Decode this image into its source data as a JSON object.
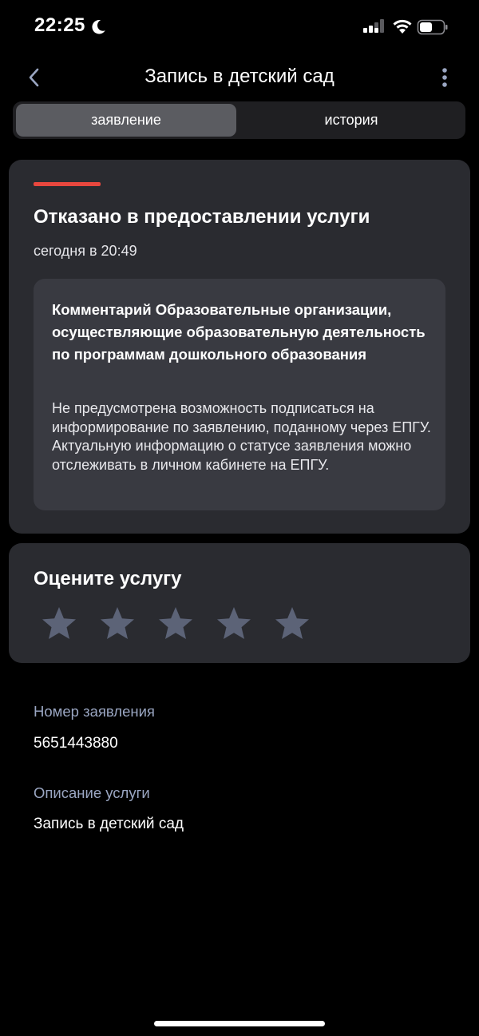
{
  "status_bar": {
    "time": "22:25"
  },
  "header": {
    "title": "Запись в детский сад"
  },
  "tabs": [
    {
      "label": "заявление",
      "active": true
    },
    {
      "label": "история",
      "active": false
    }
  ],
  "status_card": {
    "accent_color": "#e8473e",
    "title": "Отказано в предоставлении услуги",
    "time": "сегодня в 20:49",
    "comment_title": "Комментарий Образовательные организации, осуществляющие образовательную деятельность по программам дошкольного образования",
    "comment_text": "Не предусмотрена возможность подписаться на информирование по заявлению, поданному через ЕПГУ. Актуальную информацию о статусе заявления можно отслеживать в личном кабинете на ЕПГУ."
  },
  "rating": {
    "title": "Оцените услугу",
    "max_stars": 5,
    "selected": 0
  },
  "details": {
    "number_label": "Номер заявления",
    "number_value": "5651443880",
    "description_label": "Описание услуги",
    "description_value": "Запись в детский сад"
  }
}
